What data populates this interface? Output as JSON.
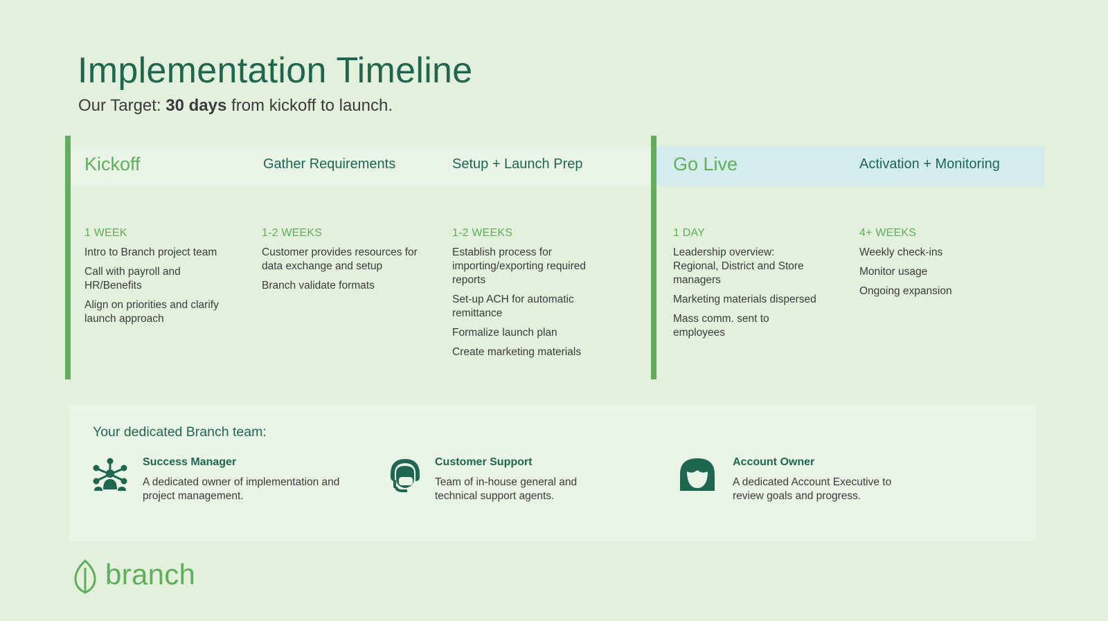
{
  "page": {
    "title": "Implementation Timeline",
    "subtitle_prefix": "Our Target: ",
    "subtitle_bold": "30 days",
    "subtitle_suffix": " from kickoff to launch."
  },
  "phases": [
    {
      "name": "Kickoff",
      "duration": "1 WEEK",
      "tasks": [
        "Intro to Branch project team",
        "Call with payroll and HR/Benefits",
        "Align on priorities and clarify launch approach"
      ]
    },
    {
      "name": "Gather Requirements",
      "duration": "1-2 WEEKS",
      "tasks": [
        "Customer provides resources for data exchange and setup",
        "Branch validate formats"
      ]
    },
    {
      "name": "Setup + Launch Prep",
      "duration": "1-2 WEEKS",
      "tasks": [
        "Establish process for importing/exporting required reports",
        "Set-up ACH for automatic remittance",
        "Formalize launch plan",
        "Create marketing materials"
      ]
    },
    {
      "name": "Go Live",
      "duration": "1 DAY",
      "tasks": [
        "Leadership overview: Regional, District and Store managers",
        "Marketing materials dispersed",
        "Mass comm. sent to employees"
      ]
    },
    {
      "name": "Activation + Monitoring",
      "duration": "4+ WEEKS",
      "tasks": [
        "Weekly check-ins",
        "Monitor usage",
        "Ongoing expansion"
      ]
    }
  ],
  "team": {
    "title": "Your dedicated Branch team:",
    "members": [
      {
        "role": "Success Manager",
        "description": "A dedicated owner of implementation and project management.",
        "icon": "network-people-icon"
      },
      {
        "role": "Customer Support",
        "description": "Team of in-house general and technical support agents.",
        "icon": "headset-agent-icon"
      },
      {
        "role": "Account Owner",
        "description": "A dedicated Account Executive to review goals and progress.",
        "icon": "person-avatar-icon"
      }
    ]
  },
  "logo": {
    "text": "branch",
    "icon": "leaf-icon"
  },
  "colors": {
    "background": "#e2f0dc",
    "primary_dark": "#1f6650",
    "accent_green": "#5fae5a",
    "phase_band": "#eaf4e6",
    "live_band": "#d3ecee"
  }
}
